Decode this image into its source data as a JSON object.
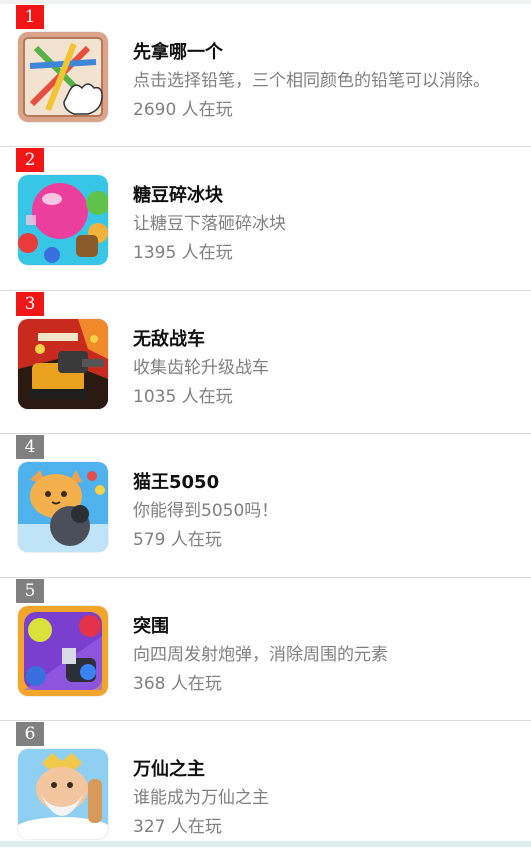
{
  "players_suffix": "人在玩",
  "colors": {
    "rank_top": "#f21515",
    "rank_other": "#808080",
    "text_secondary": "#808080"
  },
  "games": [
    {
      "rank": "1",
      "title": "先拿哪一个",
      "description": "点击选择铅笔，三个相同颜色的铅笔可以消除。",
      "players": "2690 人在玩",
      "icon": "pencils-hand-icon"
    },
    {
      "rank": "2",
      "title": "糖豆碎冰块",
      "description": "让糖豆下落砸碎冰块",
      "players": "1395 人在玩",
      "icon": "candy-bubbles-icon"
    },
    {
      "rank": "3",
      "title": "无敌战车",
      "description": "收集齿轮升级战车",
      "players": "1035 人在玩",
      "icon": "battle-tank-icon"
    },
    {
      "rank": "4",
      "title": "猫王5050",
      "description": "你能得到5050吗！",
      "players": "579 人在玩",
      "icon": "cat-cannon-icon"
    },
    {
      "rank": "5",
      "title": "突围",
      "description": "向四周发射炮弹，消除周围的元素",
      "players": "368 人在玩",
      "icon": "cannon-gems-icon"
    },
    {
      "rank": "6",
      "title": "万仙之主",
      "description": "谁能成为万仙之主",
      "players": "327 人在玩",
      "icon": "immortal-elder-icon"
    }
  ]
}
